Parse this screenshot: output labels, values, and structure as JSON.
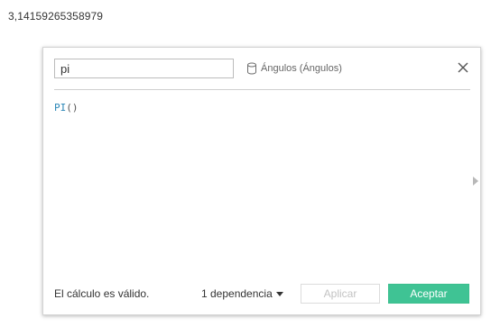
{
  "result": {
    "value": "3,14159265358979"
  },
  "dialog": {
    "name_input": {
      "value": "pi"
    },
    "datasource": {
      "icon": "database-icon",
      "label": "Ángulos (Ángulos)"
    },
    "close": {
      "icon": "close-icon"
    },
    "formula": {
      "function": "PI",
      "args": "()"
    },
    "status": "El cálculo es válido.",
    "dependency_label": "1 dependencia",
    "apply_label": "Aplicar",
    "ok_label": "Aceptar",
    "colors": {
      "accent": "#3fc394",
      "function_keyword": "#2a86b7",
      "disabled_text": "#c3c3c3"
    }
  }
}
